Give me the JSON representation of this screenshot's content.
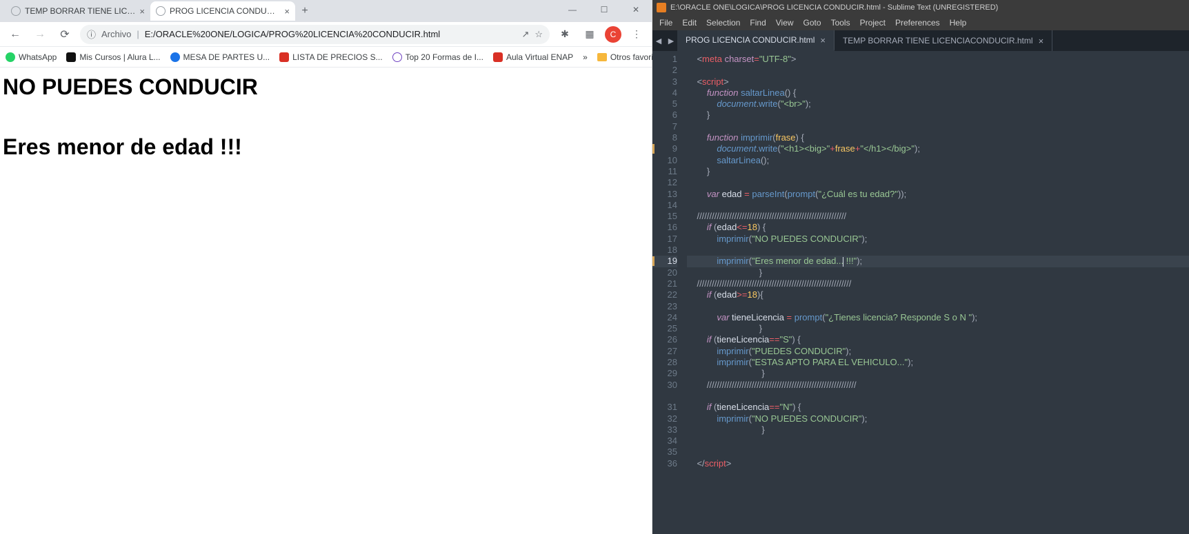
{
  "chrome": {
    "tabs": [
      {
        "title": "TEMP BORRAR TIENE LICENCIAC",
        "active": false
      },
      {
        "title": "PROG LICENCIA CONDUCIR.html",
        "active": true
      }
    ],
    "url_label": "Archivo",
    "url": "E:/ORACLE%20ONE/LOGICA/PROG%20LICENCIA%20CONDUCIR.html",
    "avatar": "C",
    "bookmarks": [
      {
        "label": "WhatsApp",
        "color": "#25d366"
      },
      {
        "label": "Mis Cursos | Alura L...",
        "color": "#111"
      },
      {
        "label": "MESA DE PARTES U...",
        "color": "#1a73e8"
      },
      {
        "label": "LISTA DE PRECIOS S...",
        "color": "#d93025"
      },
      {
        "label": "Top 20 Formas de I...",
        "color": "#6f42c1"
      },
      {
        "label": "Aula Virtual ENAP",
        "color": "#d93025"
      }
    ],
    "bookmarks_overflow": "»",
    "bookmarks_other": "Otros favoritos",
    "page": {
      "h1a": "NO PUEDES CONDUCIR",
      "h1b": "Eres menor de edad !!!"
    }
  },
  "sublime": {
    "title": "E:\\ORACLE ONE\\LOGICA\\PROG LICENCIA CONDUCIR.html - Sublime Text (UNREGISTERED)",
    "menu": [
      "File",
      "Edit",
      "Selection",
      "Find",
      "View",
      "Goto",
      "Tools",
      "Project",
      "Preferences",
      "Help"
    ],
    "tabs": [
      {
        "title": "PROG LICENCIA CONDUCIR.html",
        "active": true
      },
      {
        "title": "TEMP BORRAR TIENE LICENCIACONDUCIR.html",
        "active": false
      }
    ],
    "gutter": [
      {
        "n": "1"
      },
      {
        "n": "2"
      },
      {
        "n": "3"
      },
      {
        "n": "4"
      },
      {
        "n": "5"
      },
      {
        "n": "6"
      },
      {
        "n": "7"
      },
      {
        "n": "8"
      },
      {
        "n": "9",
        "mod": true
      },
      {
        "n": "10"
      },
      {
        "n": "11"
      },
      {
        "n": "12"
      },
      {
        "n": "13"
      },
      {
        "n": "14"
      },
      {
        "n": "15"
      },
      {
        "n": "16"
      },
      {
        "n": "17"
      },
      {
        "n": "18"
      },
      {
        "n": "19",
        "mod": true,
        "cur": true
      },
      {
        "n": "20"
      },
      {
        "n": "21"
      },
      {
        "n": "22"
      },
      {
        "n": "23"
      },
      {
        "n": "24"
      },
      {
        "n": "25"
      },
      {
        "n": "26"
      },
      {
        "n": "27"
      },
      {
        "n": "28"
      },
      {
        "n": "29"
      },
      {
        "n": "30"
      },
      {
        "n": ""
      },
      {
        "n": "31"
      },
      {
        "n": "32"
      },
      {
        "n": "33"
      },
      {
        "n": "34"
      },
      {
        "n": "35"
      },
      {
        "n": "36"
      }
    ],
    "code": [
      {
        "t": "meta",
        "indent": 1
      },
      {
        "t": "blank"
      },
      {
        "t": "script_open",
        "indent": 1
      },
      {
        "t": "func_saltar",
        "indent": 2
      },
      {
        "t": "doc_write_br",
        "indent": 3
      },
      {
        "t": "brace_close",
        "indent": 2
      },
      {
        "t": "blank"
      },
      {
        "t": "func_imprimir",
        "indent": 2
      },
      {
        "t": "doc_write_h1",
        "indent": 3
      },
      {
        "t": "call_saltar",
        "indent": 3
      },
      {
        "t": "brace_close",
        "indent": 2
      },
      {
        "t": "blank"
      },
      {
        "t": "var_edad",
        "indent": 2
      },
      {
        "t": "blank"
      },
      {
        "t": "slashes",
        "indent": 1,
        "len": 60
      },
      {
        "t": "if_edad_le",
        "indent": 2
      },
      {
        "t": "imp_no_puedes",
        "indent": 3
      },
      {
        "t": "blank"
      },
      {
        "t": "imp_menor",
        "indent": 3,
        "cur": true
      },
      {
        "t": "brace_close_far",
        "indent": 0
      },
      {
        "t": "slashes",
        "indent": 1,
        "len": 62
      },
      {
        "t": "if_edad_ge",
        "indent": 2
      },
      {
        "t": "blank"
      },
      {
        "t": "var_tiene",
        "indent": 3
      },
      {
        "t": "brace_close_far",
        "indent": 0
      },
      {
        "t": "if_tiene_s",
        "indent": 2
      },
      {
        "t": "imp_puedes",
        "indent": 3
      },
      {
        "t": "imp_apto",
        "indent": 3
      },
      {
        "t": "brace_close_far2",
        "indent": 0
      },
      {
        "t": "slashes",
        "indent": 2,
        "len": 60
      },
      {
        "t": "blank"
      },
      {
        "t": "if_tiene_n",
        "indent": 2
      },
      {
        "t": "imp_no_puedes",
        "indent": 3
      },
      {
        "t": "brace_close_far2",
        "indent": 0
      },
      {
        "t": "blank"
      },
      {
        "t": "blank"
      },
      {
        "t": "script_close",
        "indent": 1
      }
    ],
    "strings": {
      "br": "\"<br>\"",
      "h1big_a": "\"<h1><big>\"",
      "h1big_b": "\"</h1></big>\"",
      "prompt_edad": "\"¿Cuál es tu edad?\"",
      "no_puedes": "\"NO PUEDES CONDUCIR\"",
      "menor_a": "\"Eres menor de edad...",
      "menor_b": " !!!\"",
      "prompt_lic": "\"¿Tienes licencia? Responde S o N \"",
      "S": "\"S\"",
      "puedes": "\"PUEDES CONDUCIR\"",
      "apto": "\"ESTAS APTO PARA EL VEHICULO...\"",
      "N": "\"N\""
    }
  }
}
